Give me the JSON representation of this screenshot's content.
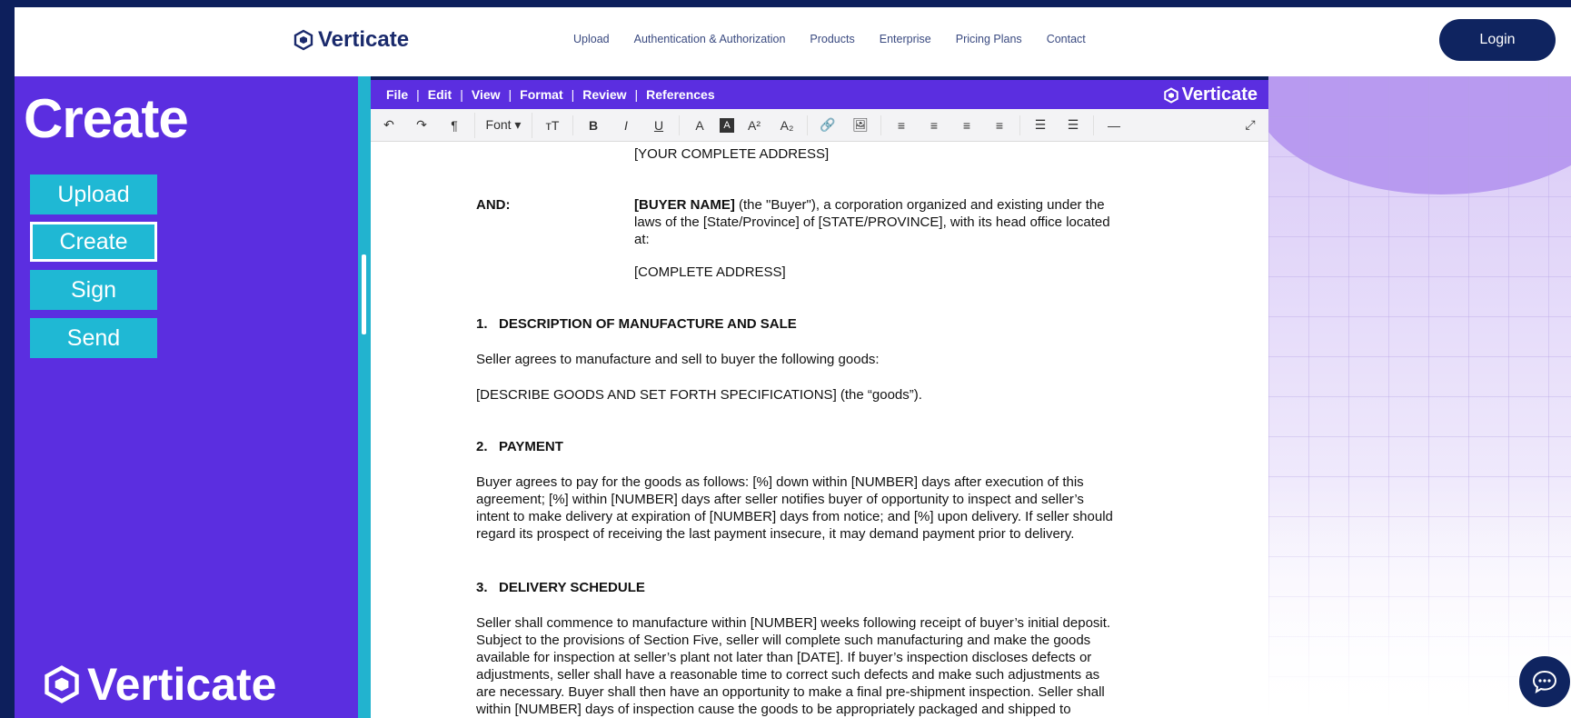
{
  "brand": "Verticate",
  "nav": {
    "links": [
      "Upload",
      "Authentication & Authorization",
      "Products",
      "Enterprise",
      "Pricing Plans",
      "Contact"
    ],
    "login": "Login"
  },
  "sidebar": {
    "title": "Create",
    "buttons": [
      "Upload",
      "Create",
      "Sign",
      "Send"
    ],
    "active": "Create",
    "brand": "Verticate"
  },
  "editor": {
    "menu": [
      "File",
      "Edit",
      "View",
      "Format",
      "Review",
      "References"
    ],
    "brand": "Verticate",
    "toolbar": {
      "undo": "↶",
      "redo": "↷",
      "paragraph": "¶",
      "font": "Font ▾",
      "font_size": "ᴛT",
      "bold": "B",
      "italic": "I",
      "underline": "U",
      "font_color": "A",
      "highlight": "A",
      "superscript": "A²",
      "subscript": "A₂",
      "link": "🔗",
      "image": "🖼",
      "align_left": "≡",
      "align_center": "≡",
      "align_right": "≡",
      "justify": "≡",
      "bullet_list": "☰",
      "numbered_list": "☰",
      "hr": "—",
      "fullscreen": "⤢"
    }
  },
  "document": {
    "address_line": "[YOUR COMPLETE ADDRESS]",
    "and_label": "AND:",
    "buyer_name": "[BUYER NAME]",
    "buyer_text_1": " (the \"Buyer\"), a corporation organized and existing under the",
    "buyer_text_2": "laws of the [State/Province] of [STATE/PROVINCE], with its head office located",
    "buyer_text_3": "at:",
    "buyer_address": "[COMPLETE ADDRESS]",
    "s1_heading": "1.   DESCRIPTION OF MANUFACTURE AND SALE",
    "s1_p1": "Seller agrees to manufacture and sell to buyer the following goods:",
    "s1_p2": "[DESCRIBE GOODS AND SET FORTH SPECIFICATIONS] (the “goods”).",
    "s2_heading": "2.   PAYMENT",
    "s2_lines": [
      "Buyer agrees to pay for the goods as follows: [%] down within [NUMBER] days after execution of this",
      "agreement; [%] within [NUMBER] days after seller notifies buyer of opportunity to inspect and seller’s",
      "intent to make delivery at expiration of [NUMBER] days from notice; and [%] upon delivery. If seller should",
      "regard its prospect of receiving the last payment insecure, it may demand payment prior to delivery."
    ],
    "s3_heading": "3.   DELIVERY SCHEDULE",
    "s3_lines": [
      "Seller shall commence to manufacture within [NUMBER] weeks following receipt of buyer’s initial deposit.",
      "Subject to the provisions of Section Five, seller will complete such manufacturing and make the goods",
      "available for inspection at seller’s plant not later than [DATE]. If buyer’s inspection discloses defects or",
      "adjustments, seller shall have a reasonable time to correct such defects and make such adjustments as",
      "are necessary. Buyer shall then have an opportunity to make a final pre-shipment inspection. Seller shall",
      "within [NUMBER] days of inspection cause the goods to be appropriately packaged and shipped to"
    ]
  },
  "colors": {
    "navy": "#0d1f5c",
    "purple": "#5b2ee0",
    "cyan": "#1fb8d4",
    "login_bg": "#0f2460"
  },
  "icons": [
    "verticate-logo-icon",
    "chat-icon"
  ]
}
